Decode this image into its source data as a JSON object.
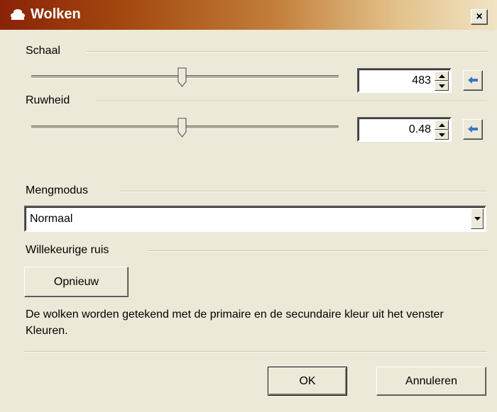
{
  "window": {
    "title": "Wolken",
    "close_label": "×",
    "icon": "clouds-icon"
  },
  "scale": {
    "label": "Schaal",
    "value": "483",
    "slider_fraction": 0.52
  },
  "roughness": {
    "label": "Ruwheid",
    "value": "0.48",
    "slider_fraction": 0.52
  },
  "blend_mode": {
    "label": "Mengmodus",
    "selected": "Normaal"
  },
  "random_noise": {
    "label": "Willekeurige ruis",
    "reseed_label": "Opnieuw"
  },
  "description": "De wolken worden getekend met de primaire en de secundaire kleur uit het venster Kleuren.",
  "buttons": {
    "ok": "OK",
    "cancel": "Annuleren"
  },
  "colors": {
    "title_dark": "#8a2308",
    "title_light": "#f1e4c4",
    "face": "#ece9d8",
    "reset_arrow": "#3a78c8"
  }
}
